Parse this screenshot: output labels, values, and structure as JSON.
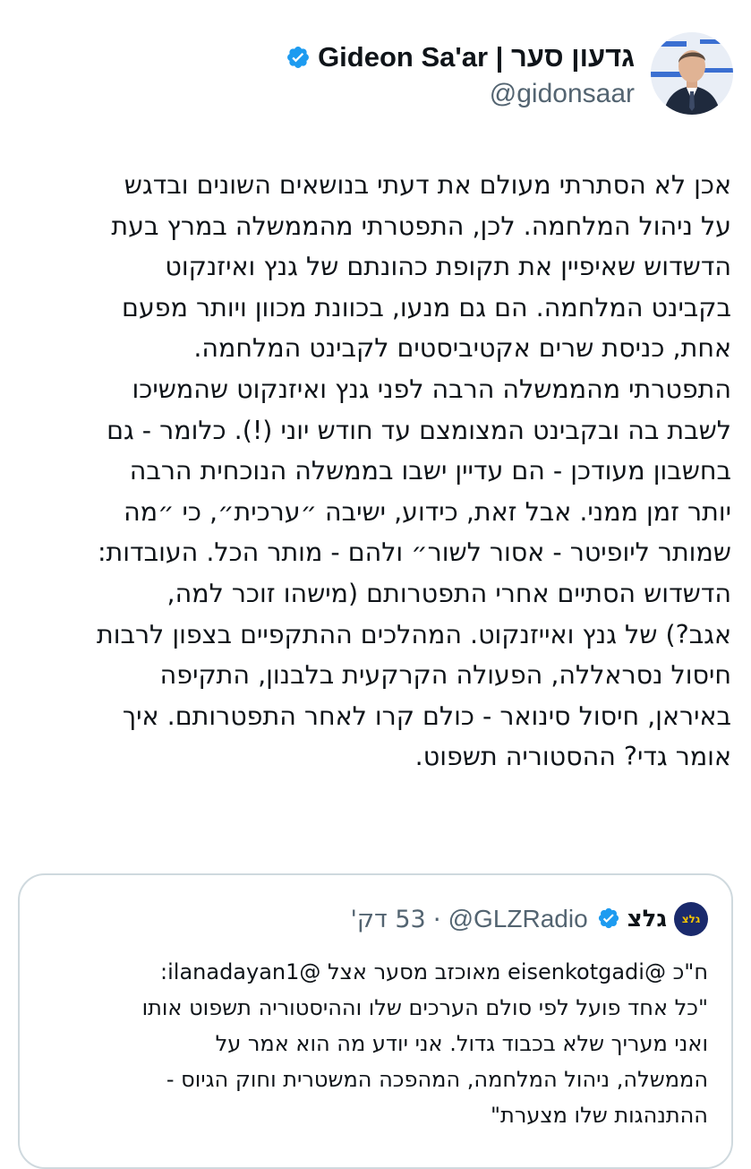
{
  "author": {
    "display_name": "גדעון סער | Gideon Sa'ar",
    "handle": "@gidonsaar",
    "verified_icon": "verified-badge-icon",
    "accent_color": "#1d9bf0"
  },
  "tweet": {
    "lines": [
      "אכן לא הסתרתי מעולם את דעתי בנושאים השונים ובדגש",
      "על ניהול המלחמה. לכן, התפטרתי מהממשלה במרץ בעת",
      "הדשדוש שאיפיין את תקופת כהונתם של גנץ ואיזנקוט",
      "בקבינט המלחמה. הם גם מנעו, בכוונת מכוון ויותר מפעם",
      "אחת, כניסת שרים אקטיביסטים לקבינט המלחמה.",
      "התפטרתי מהממשלה הרבה לפני גנץ ואיזנקוט שהמשיכו",
      "לשבת בה ובקבינט המצומצם עד חודש יוני (!).  כלומר - גם",
      "בחשבון מעודכן - הם עדיין ישבו בממשלה הנוכחית הרבה",
      "יותר זמן ממני. אבל זאת, כידוע, ישיבה ״ערכית״, כי ״מה",
      "שמותר ליופיטר - אסור לשור״ ולהם - מותר הכל. העובדות:",
      "הדשדוש הסתיים אחרי התפטרותם (מישהו זוכר למה,",
      "אגב?) של גנץ ואייזנקוט. המהלכים ההתקפיים בצפון לרבות",
      "חיסול נסראללה, הפעולה הקרקעית בלבנון, התקיפה",
      "באיראן, חיסול סינואר - כולם קרו לאחר התפטרותם. איך",
      "אומר גדי? ההסטוריה תשפוט."
    ]
  },
  "quote": {
    "logo_text": "גלצ",
    "name": "גלצ",
    "verified_icon": "verified-badge-icon",
    "handle": "@GLZRadio",
    "separator": "·",
    "time": "53 דק'",
    "lines": [
      "ח\"כ @eisenkotgadi מאוכזב מסער אצל @ilanadayan1:",
      "\"כל אחד פועל לפי סולם הערכים שלו וההיסטוריה תשפוט אותו",
      "ואני מעריך שלא בכבוד גדול. אני יודע מה הוא אמר על",
      "הממשלה, ניהול המלחמה, המהפכה המשטרית וחוק הגיוס -",
      "ההתנהגות שלו מצערת\""
    ]
  }
}
